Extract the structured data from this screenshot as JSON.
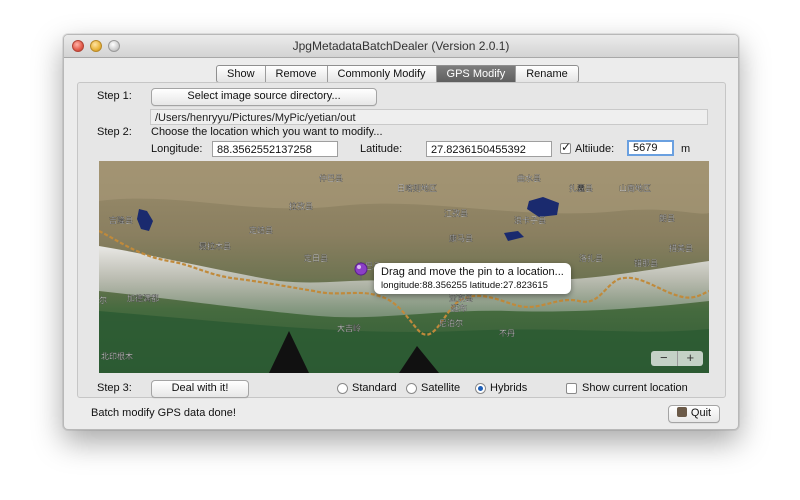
{
  "window": {
    "title": "JpgMetadataBatchDealer (Version 2.0.1)"
  },
  "tabs": [
    {
      "label": "Show",
      "active": false
    },
    {
      "label": "Remove",
      "active": false
    },
    {
      "label": "Commonly Modify",
      "active": false
    },
    {
      "label": "GPS Modify",
      "active": true
    },
    {
      "label": "Rename",
      "active": false
    }
  ],
  "step1": {
    "label": "Step 1:",
    "button": "Select image source directory...",
    "path": "/Users/henryyu/Pictures/MyPic/yetian/out"
  },
  "step2": {
    "label": "Step 2:",
    "instruction": "Choose the location which you want to modify...",
    "longitude_label": "Longitude:",
    "longitude_value": "88.3562552137258",
    "latitude_label": "Latitude:",
    "latitude_value": "27.8236150455392",
    "altitude_label": "Altiiude:",
    "altitude_checked": true,
    "altitude_value": "5679",
    "altitude_unit": "m"
  },
  "map": {
    "tooltip_line1": "Drag and move the pin to a location...",
    "tooltip_line2": "longitude:88.356255 latitude:27.823615",
    "pin_color": "#8b3fc6",
    "zoom_out": "−",
    "zoom_in": "+",
    "place_labels": [
      "日喀则地区",
      "曲水县",
      "扎囊县",
      "山南地区",
      "拉孜县",
      "江孜县",
      "康马县",
      "洛扎县",
      "浪卡子县",
      "措美县",
      "吉隆县",
      "定日县",
      "岗巴县",
      "亚东县",
      "错那县",
      "加德满都",
      "廷布",
      "大吉岭",
      "尼泊尔",
      "不丹",
      "聂拉木县",
      "定结县",
      "尔",
      "北印根木",
      "朗县",
      "仲巴县"
    ]
  },
  "step3": {
    "label": "Step 3:",
    "button": "Deal with it!",
    "map_types": [
      {
        "label": "Standard",
        "selected": false
      },
      {
        "label": "Satellite",
        "selected": false
      },
      {
        "label": "Hybrids",
        "selected": true
      }
    ],
    "show_location_label": "Show current location",
    "show_location_checked": false
  },
  "status": {
    "text": "Batch modify GPS data done!"
  },
  "quit_button": "Quit"
}
